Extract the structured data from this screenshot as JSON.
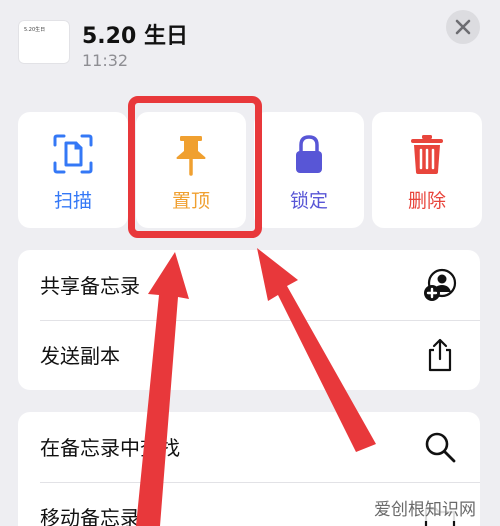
{
  "note": {
    "thumbnail_text": "5.20生日",
    "title": "5.20 生日",
    "time": "11:32"
  },
  "actions": [
    {
      "label": "扫描",
      "icon": "scan-document-icon",
      "color": "#3478f6"
    },
    {
      "label": "置顶",
      "icon": "pin-icon",
      "color": "#f0a030"
    },
    {
      "label": "锁定",
      "icon": "lock-icon",
      "color": "#5856d6"
    },
    {
      "label": "删除",
      "icon": "trash-icon",
      "color": "#e8453c"
    }
  ],
  "menu_group_1": [
    {
      "label": "共享备忘录",
      "icon": "share-note-person-add-icon"
    },
    {
      "label": "发送副本",
      "icon": "share-export-icon"
    }
  ],
  "menu_group_2": [
    {
      "label": "在备忘录中查找",
      "icon": "search-icon"
    },
    {
      "label": "移动备忘录",
      "icon": "folder-move-icon"
    }
  ],
  "annotation": {
    "highlight_color": "#e8383b"
  },
  "watermark": "爱创根知识网"
}
